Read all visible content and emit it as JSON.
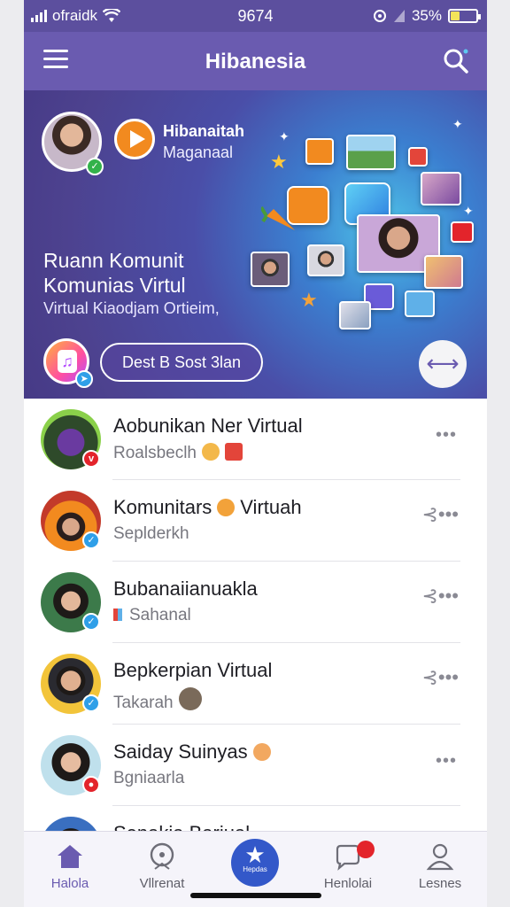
{
  "status_bar": {
    "carrier": "ofraidk",
    "time": "9674",
    "battery": "35%",
    "battery_level": 0.35
  },
  "app_bar": {
    "title": "Hibanesia"
  },
  "hero": {
    "name": "Hibanaitah",
    "subtitle": "Maganaal",
    "headline_1": "Ruann Komunit",
    "headline_2": "Komunias Virtul",
    "tagline": "Virtual Kiaodjam Ortieim,",
    "pill_label": "Dest B Sost 3lan",
    "swap_symbol": "⟷"
  },
  "list": [
    {
      "name": "Aobunikan Ner Virtual",
      "sub": "Roalsbeclh",
      "action": "more"
    },
    {
      "name": "Komunitars",
      "name_suffix": "Virtuah",
      "sub": "Seplderkh",
      "action": "share"
    },
    {
      "name": "Bubanaiianuakla",
      "sub": "Sahanal",
      "action": "share"
    },
    {
      "name": "Bepkerpian Virtual",
      "sub": "Takarah",
      "action": "share"
    },
    {
      "name": "Saiday Suinyas",
      "sub": "Bgniaarla",
      "action": "more"
    },
    {
      "name": "Senakia Bariual",
      "sub": "",
      "action": "more"
    }
  ],
  "bottom_nav": {
    "tabs": [
      {
        "label": "Halola"
      },
      {
        "label": "Vllrenat"
      },
      {
        "label": "Hepdas"
      },
      {
        "label": "Henlolai"
      },
      {
        "label": "Lesnes"
      }
    ]
  },
  "colors": {
    "accent": "#6a5bb0",
    "status_bar": "#5c4f9e",
    "center_tab": "#3358c9",
    "notification": "#e3242b"
  }
}
